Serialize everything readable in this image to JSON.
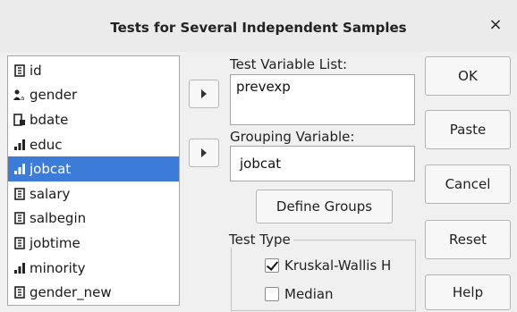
{
  "dialog": {
    "title": "Tests for Several Independent Samples",
    "close_glyph": "×"
  },
  "variables": [
    {
      "label": "id",
      "icon": "scale-variable-icon",
      "selected": false
    },
    {
      "label": "gender",
      "icon": "nominal-variable-icon",
      "selected": false
    },
    {
      "label": "bdate",
      "icon": "date-variable-icon",
      "selected": false
    },
    {
      "label": "educ",
      "icon": "ordinal-variable-icon",
      "selected": false
    },
    {
      "label": "jobcat",
      "icon": "ordinal-variable-icon",
      "selected": true
    },
    {
      "label": "salary",
      "icon": "scale-variable-icon",
      "selected": false
    },
    {
      "label": "salbegin",
      "icon": "scale-variable-icon",
      "selected": false
    },
    {
      "label": "jobtime",
      "icon": "scale-variable-icon",
      "selected": false
    },
    {
      "label": "minority",
      "icon": "ordinal-variable-icon",
      "selected": false
    },
    {
      "label": "gender_new",
      "icon": "scale-variable-icon",
      "selected": false
    }
  ],
  "test_variable": {
    "label": "Test Variable List:",
    "value": "prevexp"
  },
  "grouping_variable": {
    "label": "Grouping Variable:",
    "value": "jobcat"
  },
  "define_groups_label": "Define Groups",
  "test_type": {
    "legend": "Test Type",
    "options": [
      {
        "label": "Kruskal-Wallis H",
        "checked": true
      },
      {
        "label": "Median",
        "checked": false
      }
    ]
  },
  "buttons": {
    "ok": "OK",
    "paste": "Paste",
    "cancel": "Cancel",
    "reset": "Reset",
    "help": "Help"
  },
  "colors": {
    "selection": "#3d7bd9",
    "background": "#f0f0f0"
  }
}
